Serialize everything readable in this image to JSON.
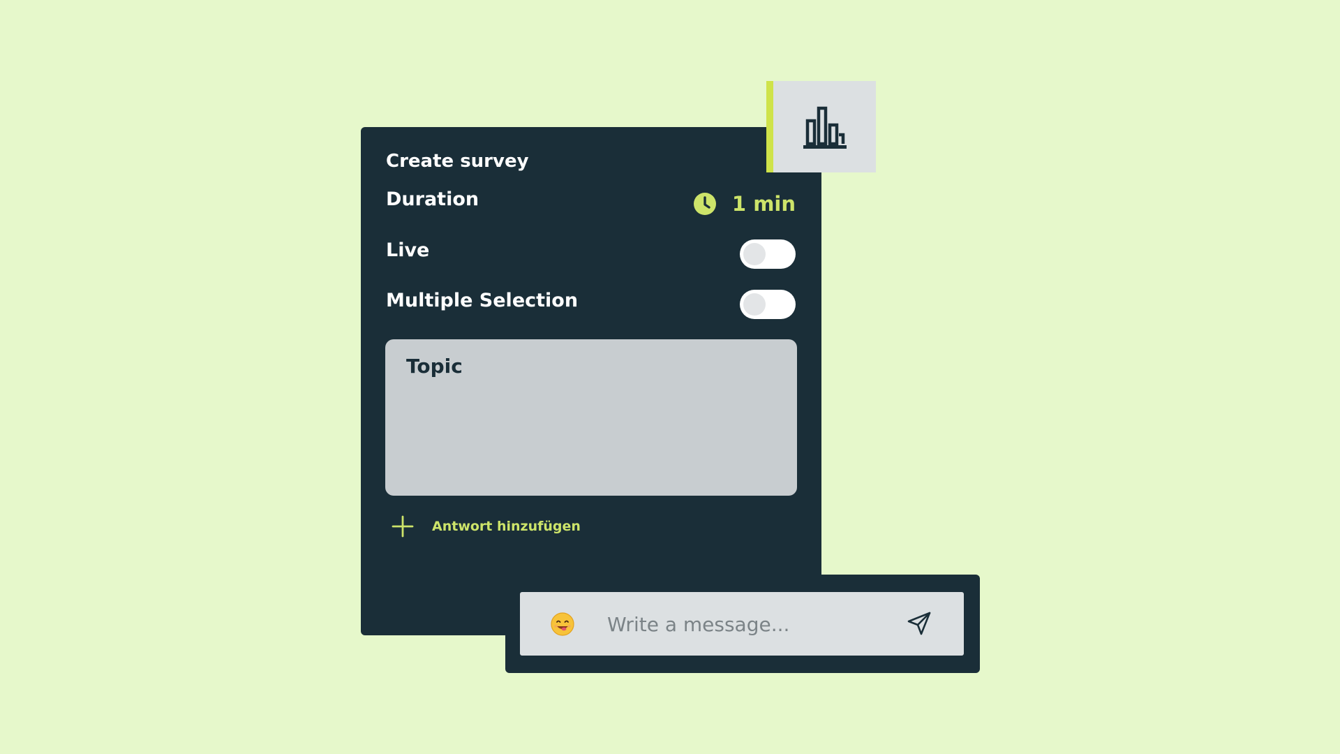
{
  "survey": {
    "title": "Create survey",
    "duration_label": "Duration",
    "duration_value": "1 min",
    "live_label": "Live",
    "live_enabled": false,
    "multiple_label": "Multiple Selection",
    "multiple_enabled": false,
    "topic_label": "Topic",
    "add_answer_label": "Antwort hinzufügen"
  },
  "chart_tab": {
    "icon": "bar-chart-icon"
  },
  "message": {
    "placeholder": "Write a message...",
    "emoji_icon": "smiley-face-icon",
    "send_icon": "paper-plane-icon"
  },
  "colors": {
    "background": "#e6f8cb",
    "panel": "#1a2e38",
    "accent": "#cde46a",
    "accent_bar": "#cfe34a",
    "input_bg": "#dce0e2",
    "topic_bg": "#c8cdd0"
  }
}
